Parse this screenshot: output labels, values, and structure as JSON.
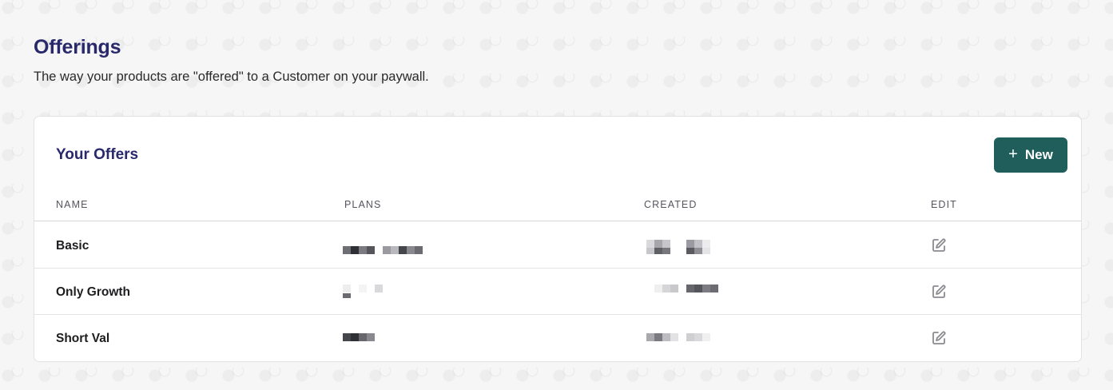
{
  "header": {
    "title": "Offerings",
    "subtitle": "The way your products are \"offered\" to a Customer on your paywall."
  },
  "card": {
    "title": "Your Offers",
    "new_button": {
      "icon": "plus-icon",
      "label": "New"
    }
  },
  "table": {
    "columns": [
      "NAME",
      "PLANS",
      "CREATED",
      "EDIT"
    ],
    "rows": [
      {
        "name": "Basic"
      },
      {
        "name": "Only Growth"
      },
      {
        "name": "Short Val"
      }
    ]
  },
  "colors": {
    "title": "#28286a",
    "accent_button": "#1f5e5b"
  }
}
